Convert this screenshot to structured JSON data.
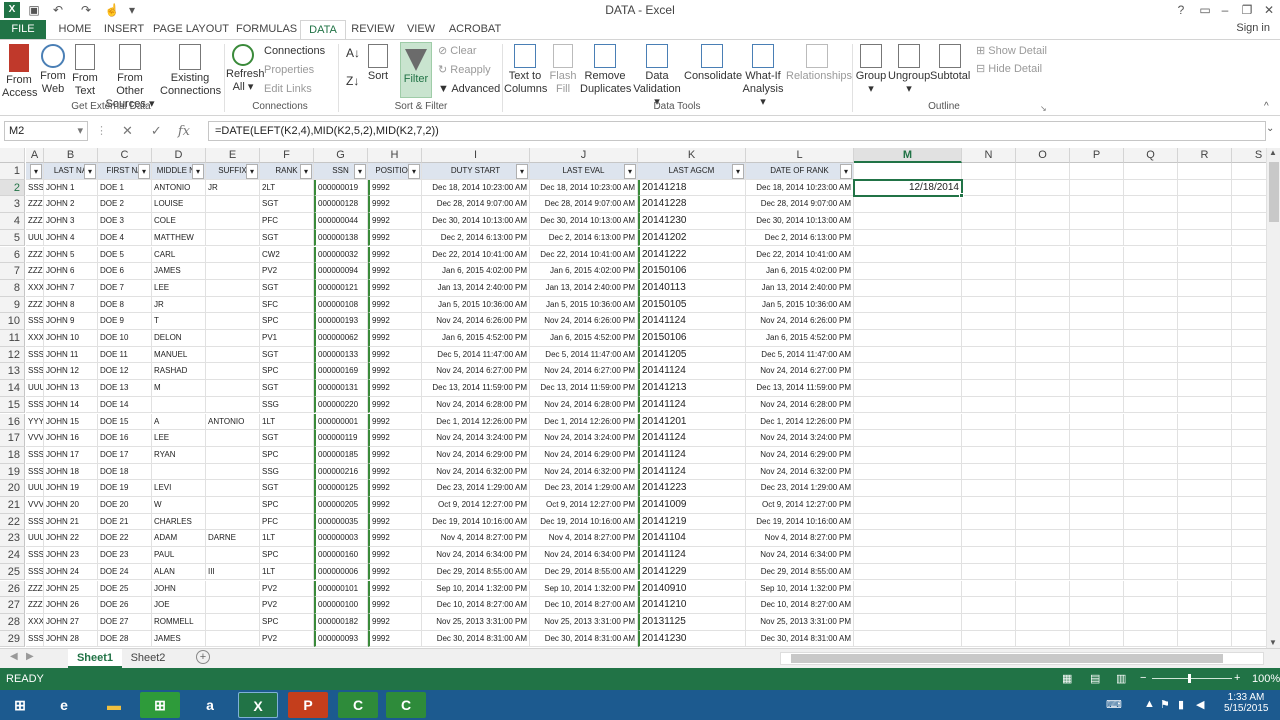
{
  "window": {
    "title": "DATA - Excel"
  },
  "ribbon_tabs": [
    "FILE",
    "HOME",
    "INSERT",
    "PAGE LAYOUT",
    "FORMULAS",
    "DATA",
    "REVIEW",
    "VIEW",
    "ACROBAT"
  ],
  "signin": "Sign in",
  "ribbon": {
    "get_external": {
      "buttons": [
        "From\nAccess",
        "From\nWeb",
        "From\nText",
        "From Other\nSources ▾",
        "Existing\nConnections"
      ],
      "label": "Get External Data"
    },
    "connections": {
      "refresh": "Refresh\nAll ▾",
      "items": [
        "Connections",
        "Properties",
        "Edit Links"
      ],
      "label": "Connections"
    },
    "sort_filter": {
      "sort": "Sort",
      "filter": "Filter",
      "items": [
        "Clear",
        "Reapply",
        "Advanced"
      ],
      "label": "Sort & Filter"
    },
    "data_tools": {
      "buttons": [
        "Text to\nColumns",
        "Flash\nFill",
        "Remove\nDuplicates",
        "Data\nValidation ▾",
        "Consolidate",
        "What-If\nAnalysis ▾",
        "Relationships"
      ],
      "label": "Data Tools"
    },
    "outline": {
      "buttons": [
        "Group\n▾",
        "Ungroup\n▾",
        "Subtotal"
      ],
      "items": [
        "Show Detail",
        "Hide Detail"
      ],
      "label": "Outline"
    }
  },
  "namebox": "M2",
  "fx": "fx",
  "formula": "=DATE(LEFT(K2,4),MID(K2,5,2),MID(K2,7,2))",
  "columns": [
    "A",
    "B",
    "C",
    "D",
    "E",
    "F",
    "G",
    "H",
    "I",
    "J",
    "K",
    "L",
    "M",
    "N",
    "O",
    "P",
    "Q",
    "R",
    "S"
  ],
  "headers": [
    "",
    "LAST NA",
    "FIRST NA",
    "MIDDLE NA",
    "SUFFIX",
    "RANK",
    "SSN",
    "POSITION",
    "DUTY START",
    "LAST EVAL",
    "LAST AGCM",
    "DATE OF RANK"
  ],
  "m2_value": "12/18/2014",
  "rows": [
    [
      "SSS",
      "JOHN 1",
      "DOE 1",
      "ANTONIO",
      "JR",
      "2LT",
      "000000019",
      "9992",
      "Dec 18, 2014 10:23:00 AM",
      "Dec 18, 2014 10:23:00 AM",
      "20141218",
      "Dec 18, 2014 10:23:00 AM"
    ],
    [
      "ZZZ",
      "JOHN 2",
      "DOE 2",
      "LOUISE",
      "",
      "SGT",
      "000000128",
      "9992",
      "Dec 28, 2014 9:07:00 AM",
      "Dec 28, 2014 9:07:00 AM",
      "20141228",
      "Dec 28, 2014 9:07:00 AM"
    ],
    [
      "ZZZ",
      "JOHN 3",
      "DOE 3",
      "COLE",
      "",
      "PFC",
      "000000044",
      "9992",
      "Dec 30, 2014 10:13:00 AM",
      "Dec 30, 2014 10:13:00 AM",
      "20141230",
      "Dec 30, 2014 10:13:00 AM"
    ],
    [
      "UUU",
      "JOHN 4",
      "DOE 4",
      "MATTHEW",
      "",
      "SGT",
      "000000138",
      "9992",
      "Dec 2, 2014 6:13:00 PM",
      "Dec 2, 2014 6:13:00 PM",
      "20141202",
      "Dec 2, 2014 6:13:00 PM"
    ],
    [
      "ZZZ",
      "JOHN 5",
      "DOE 5",
      "CARL",
      "",
      "CW2",
      "000000032",
      "9992",
      "Dec 22, 2014 10:41:00 AM",
      "Dec 22, 2014 10:41:00 AM",
      "20141222",
      "Dec 22, 2014 10:41:00 AM"
    ],
    [
      "ZZZ",
      "JOHN 6",
      "DOE 6",
      "JAMES",
      "",
      "PV2",
      "000000094",
      "9992",
      "Jan 6, 2015 4:02:00 PM",
      "Jan 6, 2015 4:02:00 PM",
      "20150106",
      "Jan 6, 2015 4:02:00 PM"
    ],
    [
      "XXX",
      "JOHN 7",
      "DOE 7",
      "LEE",
      "",
      "SGT",
      "000000121",
      "9992",
      "Jan 13, 2014 2:40:00 PM",
      "Jan 13, 2014 2:40:00 PM",
      "20140113",
      "Jan 13, 2014 2:40:00 PM"
    ],
    [
      "ZZZ",
      "JOHN 8",
      "DOE 8",
      "JR",
      "",
      "SFC",
      "000000108",
      "9992",
      "Jan 5, 2015 10:36:00 AM",
      "Jan 5, 2015 10:36:00 AM",
      "20150105",
      "Jan 5, 2015 10:36:00 AM"
    ],
    [
      "SSS",
      "JOHN 9",
      "DOE 9",
      "T",
      "",
      "SPC",
      "000000193",
      "9992",
      "Nov 24, 2014 6:26:00 PM",
      "Nov 24, 2014 6:26:00 PM",
      "20141124",
      "Nov 24, 2014 6:26:00 PM"
    ],
    [
      "XXX",
      "JOHN 10",
      "DOE 10",
      "DELON",
      "",
      "PV1",
      "000000062",
      "9992",
      "Jan 6, 2015 4:52:00 PM",
      "Jan 6, 2015 4:52:00 PM",
      "20150106",
      "Jan 6, 2015 4:52:00 PM"
    ],
    [
      "SSS",
      "JOHN 11",
      "DOE 11",
      "MANUEL",
      "",
      "SGT",
      "000000133",
      "9992",
      "Dec 5, 2014 11:47:00 AM",
      "Dec 5, 2014 11:47:00 AM",
      "20141205",
      "Dec 5, 2014 11:47:00 AM"
    ],
    [
      "SSS",
      "JOHN 12",
      "DOE 12",
      "RASHAD",
      "",
      "SPC",
      "000000169",
      "9992",
      "Nov 24, 2014 6:27:00 PM",
      "Nov 24, 2014 6:27:00 PM",
      "20141124",
      "Nov 24, 2014 6:27:00 PM"
    ],
    [
      "UUU",
      "JOHN 13",
      "DOE 13",
      "M",
      "",
      "SGT",
      "000000131",
      "9992",
      "Dec 13, 2014 11:59:00 PM",
      "Dec 13, 2014 11:59:00 PM",
      "20141213",
      "Dec 13, 2014 11:59:00 PM"
    ],
    [
      "SSS",
      "JOHN 14",
      "DOE 14",
      "",
      "",
      "SSG",
      "000000220",
      "9992",
      "Nov 24, 2014 6:28:00 PM",
      "Nov 24, 2014 6:28:00 PM",
      "20141124",
      "Nov 24, 2014 6:28:00 PM"
    ],
    [
      "YYY",
      "JOHN 15",
      "DOE 15",
      "A",
      "ANTONIO",
      "1LT",
      "000000001",
      "9992",
      "Dec 1, 2014 12:26:00 PM",
      "Dec 1, 2014 12:26:00 PM",
      "20141201",
      "Dec 1, 2014 12:26:00 PM"
    ],
    [
      "VVV",
      "JOHN 16",
      "DOE 16",
      "LEE",
      "",
      "SGT",
      "000000119",
      "9992",
      "Nov 24, 2014 3:24:00 PM",
      "Nov 24, 2014 3:24:00 PM",
      "20141124",
      "Nov 24, 2014 3:24:00 PM"
    ],
    [
      "SSS",
      "JOHN 17",
      "DOE 17",
      "RYAN",
      "",
      "SPC",
      "000000185",
      "9992",
      "Nov 24, 2014 6:29:00 PM",
      "Nov 24, 2014 6:29:00 PM",
      "20141124",
      "Nov 24, 2014 6:29:00 PM"
    ],
    [
      "SSS",
      "JOHN 18",
      "DOE 18",
      "",
      "",
      "SSG",
      "000000216",
      "9992",
      "Nov 24, 2014 6:32:00 PM",
      "Nov 24, 2014 6:32:00 PM",
      "20141124",
      "Nov 24, 2014 6:32:00 PM"
    ],
    [
      "UUU",
      "JOHN 19",
      "DOE 19",
      "LEVI",
      "",
      "SGT",
      "000000125",
      "9992",
      "Dec 23, 2014 1:29:00 AM",
      "Dec 23, 2014 1:29:00 AM",
      "20141223",
      "Dec 23, 2014 1:29:00 AM"
    ],
    [
      "VVV",
      "JOHN 20",
      "DOE 20",
      "W",
      "",
      "SPC",
      "000000205",
      "9992",
      "Oct 9, 2014 12:27:00 PM",
      "Oct 9, 2014 12:27:00 PM",
      "20141009",
      "Oct 9, 2014 12:27:00 PM"
    ],
    [
      "SSS",
      "JOHN 21",
      "DOE 21",
      "CHARLES",
      "",
      "PFC",
      "000000035",
      "9992",
      "Dec 19, 2014 10:16:00 AM",
      "Dec 19, 2014 10:16:00 AM",
      "20141219",
      "Dec 19, 2014 10:16:00 AM"
    ],
    [
      "UUU",
      "JOHN 22",
      "DOE 22",
      "ADAM",
      "DARNE",
      "1LT",
      "000000003",
      "9992",
      "Nov 4, 2014 8:27:00 PM",
      "Nov 4, 2014 8:27:00 PM",
      "20141104",
      "Nov 4, 2014 8:27:00 PM"
    ],
    [
      "SSS",
      "JOHN 23",
      "DOE 23",
      "PAUL",
      "",
      "SPC",
      "000000160",
      "9992",
      "Nov 24, 2014 6:34:00 PM",
      "Nov 24, 2014 6:34:00 PM",
      "20141124",
      "Nov 24, 2014 6:34:00 PM"
    ],
    [
      "SSS",
      "JOHN 24",
      "DOE 24",
      "ALAN",
      "III",
      "1LT",
      "000000006",
      "9992",
      "Dec 29, 2014 8:55:00 AM",
      "Dec 29, 2014 8:55:00 AM",
      "20141229",
      "Dec 29, 2014 8:55:00 AM"
    ],
    [
      "ZZZ",
      "JOHN 25",
      "DOE 25",
      "JOHN",
      "",
      "PV2",
      "000000101",
      "9992",
      "Sep 10, 2014 1:32:00 PM",
      "Sep 10, 2014 1:32:00 PM",
      "20140910",
      "Sep 10, 2014 1:32:00 PM"
    ],
    [
      "ZZZ",
      "JOHN 26",
      "DOE 26",
      "JOE",
      "",
      "PV2",
      "000000100",
      "9992",
      "Dec 10, 2014 8:27:00 AM",
      "Dec 10, 2014 8:27:00 AM",
      "20141210",
      "Dec 10, 2014 8:27:00 AM"
    ],
    [
      "XXX",
      "JOHN 27",
      "DOE 27",
      "ROMMELL",
      "",
      "SPC",
      "000000182",
      "9992",
      "Nov 25, 2013 3:31:00 PM",
      "Nov 25, 2013 3:31:00 PM",
      "20131125",
      "Nov 25, 2013 3:31:00 PM"
    ],
    [
      "SSS",
      "JOHN 28",
      "DOE 28",
      "JAMES",
      "",
      "PV2",
      "000000093",
      "9992",
      "Dec 30, 2014 8:31:00 AM",
      "Dec 30, 2014 8:31:00 AM",
      "20141230",
      "Dec 30, 2014 8:31:00 AM"
    ]
  ],
  "sheets": [
    "Sheet1",
    "Sheet2"
  ],
  "status": {
    "mode": "READY",
    "zoom": "100%"
  },
  "clock": {
    "time": "1:33 AM",
    "date": "5/15/2015"
  },
  "colors": {
    "excel_green": "#217346",
    "header_fill": "#dde4ee",
    "taskbar": "#1c5a8f"
  }
}
